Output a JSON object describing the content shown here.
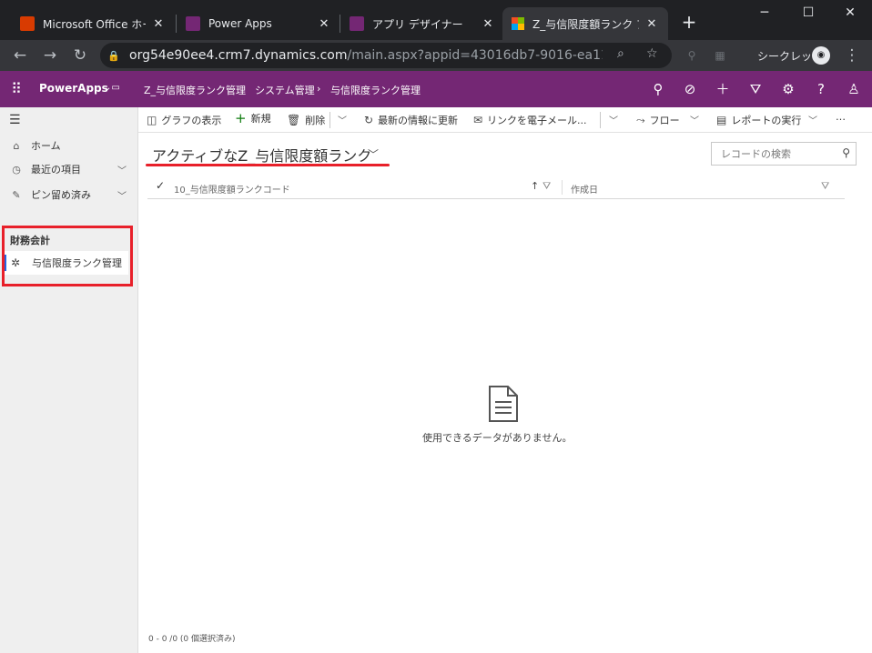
{
  "browser": {
    "tabs": [
      {
        "title": "Microsoft Office ホーム",
        "color": "#d83b01"
      },
      {
        "title": "Power Apps",
        "color": "#742774"
      },
      {
        "title": "アプリ デザイナー",
        "color": "#742774"
      },
      {
        "title": "Z_与信限度額ランク アク",
        "color": "#ffffff"
      }
    ],
    "url_host": "org54e90ee4.crm7.dynamics.com",
    "url_path": "/main.aspx?appid=43016db7-9016-ea11-a811-0...",
    "incognito_label": "シークレット"
  },
  "header": {
    "app_name": "PowerApps",
    "breadcrumb": {
      "app": "Z_与信限度ランク管理",
      "area": "システム管理",
      "entity": "与信限度ランク管理"
    },
    "icons": [
      "search-icon",
      "task-icon",
      "add-icon",
      "filter-icon",
      "settings-icon",
      "help-icon",
      "user-icon"
    ],
    "brand_color": "#742774"
  },
  "sidebar": {
    "items": [
      {
        "label": "ホーム",
        "icon": "home-icon"
      },
      {
        "label": "最近の項目",
        "icon": "clock-icon"
      },
      {
        "label": "ピン留め済み",
        "icon": "pin-icon"
      }
    ],
    "group_title": "財務会計",
    "group_item": "与信限度ランク管理"
  },
  "commandbar": {
    "chart": "グラフの表示",
    "new": "新規",
    "delete": "削除",
    "refresh": "最新の情報に更新",
    "email_link": "リンクを電子メール...",
    "flow": "フロー",
    "report": "レポートの実行",
    "more": "…"
  },
  "view": {
    "title": "アクティブなZ_与信限度額ランク",
    "search_placeholder": "レコードの検索"
  },
  "grid": {
    "columns": [
      "10_与信限度額ランクコード",
      "作成日"
    ],
    "empty_message": "使用できるデータがありません。",
    "footer": "0 - 0 /0 (0 個選択済み)"
  }
}
